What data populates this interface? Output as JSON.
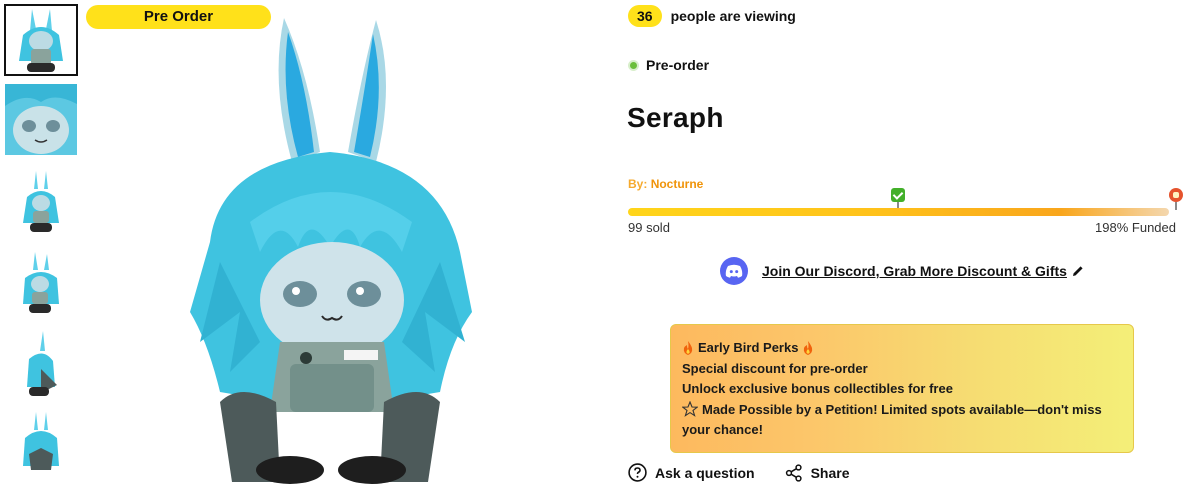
{
  "badge": {
    "label": "Pre Order"
  },
  "viewers": {
    "count": "36",
    "text": "people are viewing"
  },
  "status": {
    "label": "Pre-order",
    "dot_color": "#6bbf3b"
  },
  "product": {
    "title": "Seraph",
    "author_label": "By:",
    "author_name": "Nocturne"
  },
  "progress": {
    "sold_text": "99 sold",
    "funded_text": "198% Funded",
    "funded_percent": 198,
    "milestones": [
      {
        "icon": "check-milestone-icon",
        "position_fraction": 0.5
      },
      {
        "icon": "goal-milestone-icon",
        "position_fraction": 1.0
      }
    ]
  },
  "discord": {
    "label": "Join Our Discord, Grab More Discount & Gifts",
    "icon": "discord-icon"
  },
  "perks": {
    "title": "Early Bird Perks",
    "lines": [
      "Special discount for pre-order",
      "Unlock exclusive bonus collectibles for free",
      "Made Possible by a Petition! Limited spots available—don't miss your chance!"
    ]
  },
  "actions": {
    "ask": "Ask a question",
    "share": "Share"
  },
  "thumbnails": [
    {
      "name": "front-view",
      "selected": true
    },
    {
      "name": "face-closeup",
      "selected": false
    },
    {
      "name": "front-small",
      "selected": false
    },
    {
      "name": "angle-view",
      "selected": false
    },
    {
      "name": "side-view",
      "selected": false
    },
    {
      "name": "back-view",
      "selected": false
    }
  ],
  "colors": {
    "accent_yellow": "#ffe11a",
    "author_orange": "#f0940a",
    "discord_blurple": "#5865f2",
    "plush_cyan": "#3fc3e0"
  }
}
